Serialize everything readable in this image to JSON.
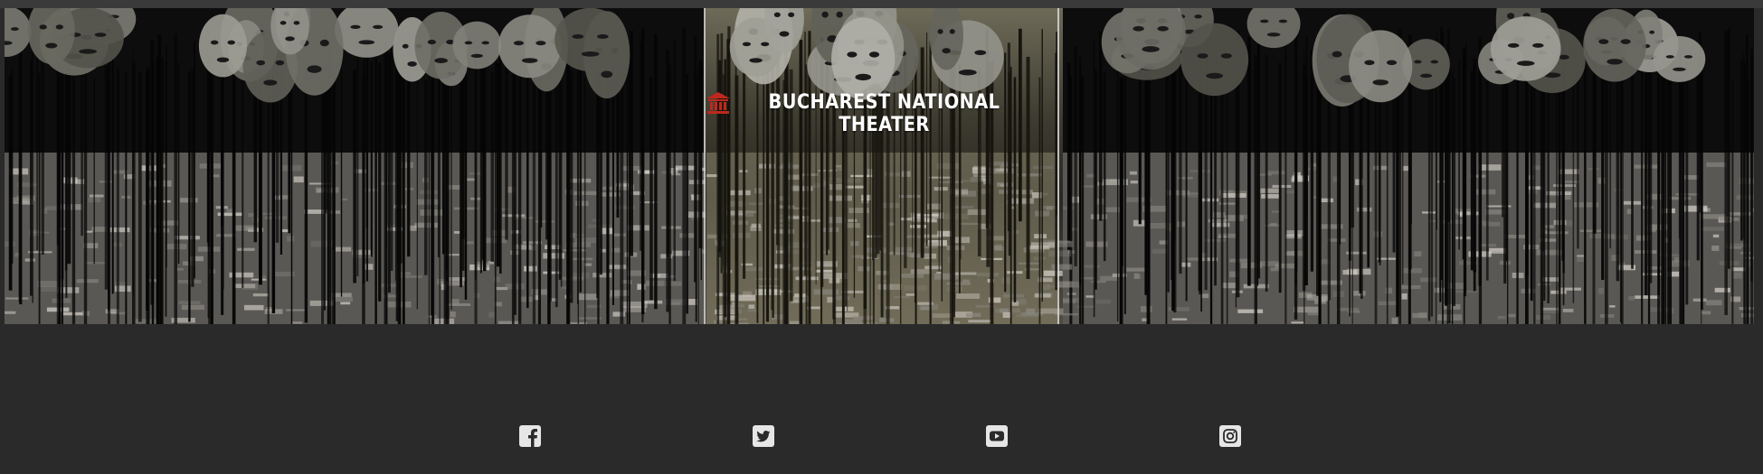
{
  "site": {
    "title": "BUCHAREST NATIONAL THEATER",
    "logo_icon": "theater-building-icon",
    "accent_color": "#c0281c"
  },
  "social": {
    "items": [
      {
        "icon": "facebook-icon",
        "name": "Facebook"
      },
      {
        "icon": "twitter-icon",
        "name": "Twitter"
      },
      {
        "icon": "youtube-icon",
        "name": "YouTube"
      },
      {
        "icon": "instagram-icon",
        "name": "Instagram"
      }
    ]
  }
}
